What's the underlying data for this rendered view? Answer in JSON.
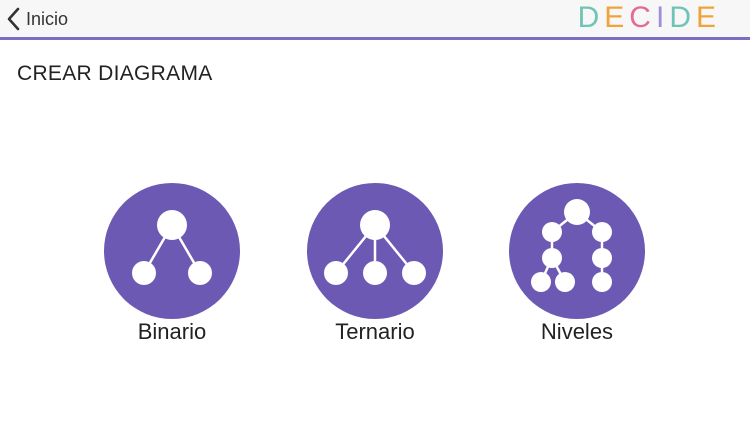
{
  "header": {
    "back_label": "Inicio",
    "back_icon": "chevron-left-icon",
    "logo_letters": [
      {
        "char": "D",
        "color": "#6fc5b5"
      },
      {
        "char": "E",
        "color": "#f0a33b"
      },
      {
        "char": "C",
        "color": "#e56b8f"
      },
      {
        "char": "I",
        "color": "#9c8fd6"
      },
      {
        "char": "D",
        "color": "#6fc5b5"
      },
      {
        "char": "E",
        "color": "#f0a33b"
      }
    ],
    "accent_color": "#7b6dc4"
  },
  "main": {
    "title": "CREAR DIAGRAMA",
    "options": [
      {
        "label": "Binario",
        "icon": "binary-tree-icon"
      },
      {
        "label": "Ternario",
        "icon": "ternary-tree-icon"
      },
      {
        "label": "Niveles",
        "icon": "levels-tree-icon"
      }
    ],
    "circle_color": "#6b59b3"
  }
}
